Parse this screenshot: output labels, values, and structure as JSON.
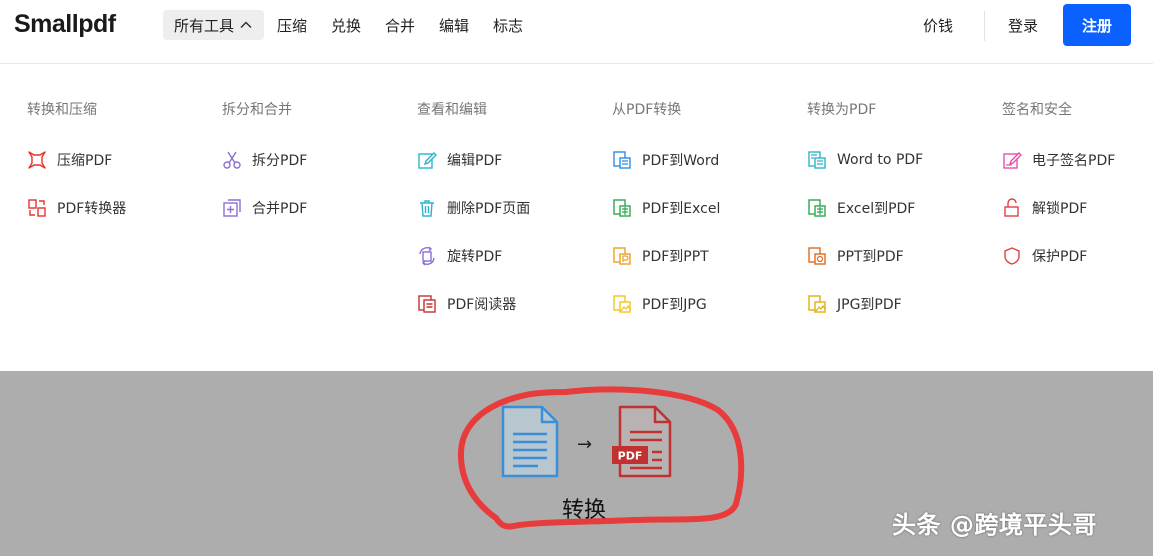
{
  "header": {
    "logo": "Smallpdf",
    "all_tools": "所有工具",
    "nav": [
      "压缩",
      "兑换",
      "合并",
      "编辑",
      "标志"
    ],
    "price": "价钱",
    "login": "登录",
    "register": "注册"
  },
  "menu": {
    "columns": [
      {
        "title": "转换和压缩",
        "items": [
          "压缩PDF",
          "PDF转换器"
        ]
      },
      {
        "title": "拆分和合并",
        "items": [
          "拆分PDF",
          "合并PDF"
        ]
      },
      {
        "title": "查看和编辑",
        "items": [
          "编辑PDF",
          "删除PDF页面",
          "旋转PDF",
          "PDF阅读器"
        ]
      },
      {
        "title": "从PDF转换",
        "items": [
          "PDF到Word",
          "PDF到Excel",
          "PDF到PPT",
          "PDF到JPG"
        ]
      },
      {
        "title": "转换为PDF",
        "items": [
          "Word to PDF",
          "Excel到PDF",
          "PPT到PDF",
          "JPG到PDF"
        ]
      },
      {
        "title": "签名和安全",
        "items": [
          "电子签名PDF",
          "解锁PDF",
          "保护PDF"
        ]
      }
    ]
  },
  "colors": {
    "brand_blue": "#0b61ff",
    "compress_red": "#e5322d",
    "split_purple": "#8c6fd1",
    "edit_teal": "#2bb5c9",
    "word_blue": "#2b8ee6",
    "excel_green": "#2ca94d",
    "ppt_orange": "#f0a020",
    "jpg_yellow": "#f5c518",
    "sign_pink": "#e84fa8",
    "reader_red": "#c8312f",
    "protect_red": "#e04040"
  },
  "convert": {
    "pdf_badge": "PDF",
    "label": "转换"
  },
  "watermark": "头条 @跨境平头哥"
}
